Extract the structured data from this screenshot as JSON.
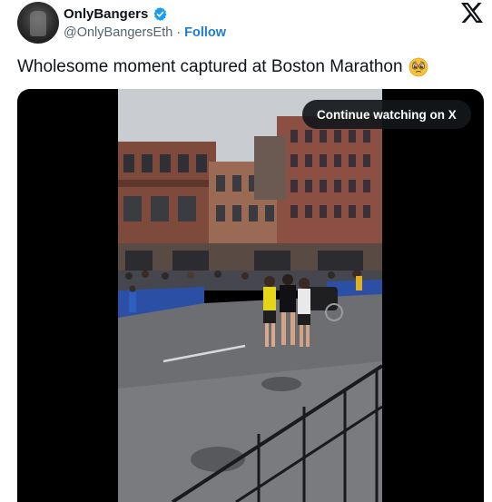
{
  "header": {
    "display_name": "OnlyBangers",
    "handle": "@OnlyBangersEth",
    "separator": "·",
    "follow_label": "Follow"
  },
  "tweet": {
    "text": "Wholesome moment captured at Boston Marathon"
  },
  "media": {
    "continue_label": "Continue watching on X"
  },
  "icons": {
    "verified": "verified-badge-icon",
    "brand": "x-logo-icon",
    "emoji": "pleading-face-emoji"
  },
  "colors": {
    "verified_blue": "#1d9bf0",
    "follow_blue": "#1d7fc7",
    "pill_bg": "#14171a"
  }
}
